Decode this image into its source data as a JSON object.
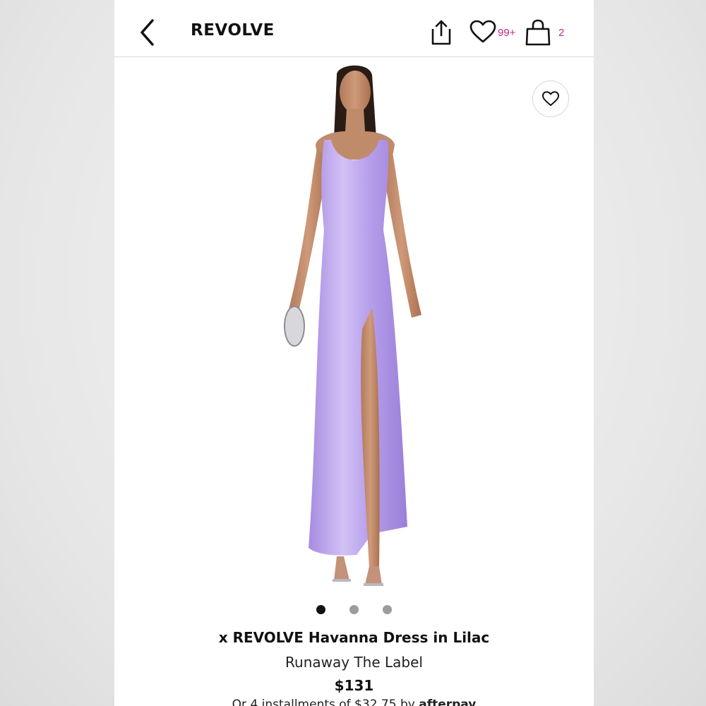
{
  "header": {
    "logo": "REVOLVE",
    "wishlist_count": "99+",
    "bag_count": "2"
  },
  "gallery": {
    "current_image": 1,
    "total_images": 3
  },
  "product": {
    "title": "x REVOLVE Havanna Dress in Lilac",
    "brand": "Runaway The Label",
    "price": "$131",
    "installments_prefix": "Or 4 installments of $32.75 by",
    "installments_provider": "afterpay"
  },
  "colors": {
    "accent": "#c2258f",
    "dress": "#b39ae8"
  },
  "icons": [
    "back-arrow-icon",
    "share-icon",
    "heart-icon",
    "bag-icon"
  ]
}
